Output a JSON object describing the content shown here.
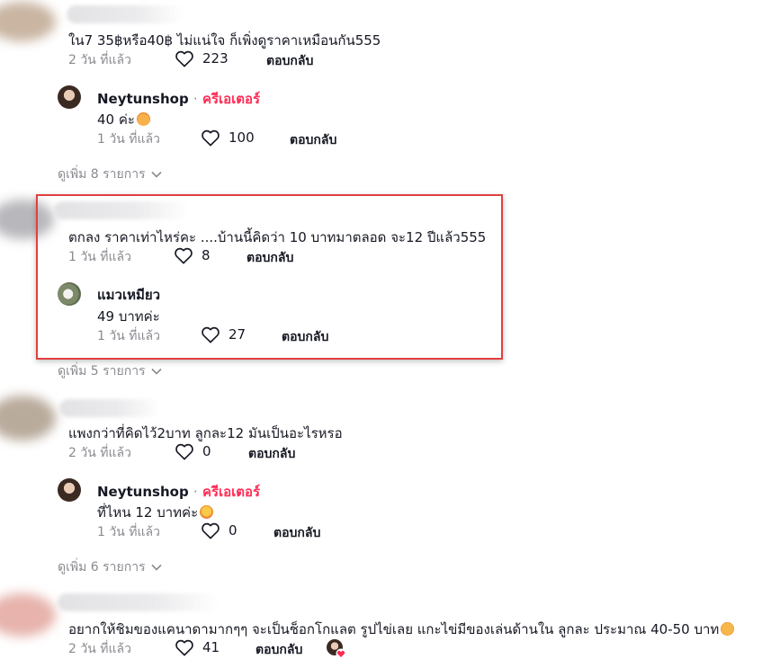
{
  "threads": [
    {
      "comment": {
        "text": "ใน7 35฿หรือ40฿ ไม่แน่ใจ ก็เพิ่งดูราคาเหมือนกัน555",
        "time": "2 วัน ที่แล้ว",
        "likes": "223",
        "reply_label": "ตอบกลับ"
      },
      "reply": {
        "username": "Neytunshop",
        "separator": "·",
        "badge": "ครีเอเตอร์",
        "text": "40 ค่ะ",
        "time": "1 วัน ที่แล้ว",
        "likes": "100",
        "reply_label": "ตอบกลับ"
      },
      "more": "ดูเพิ่ม 8 รายการ"
    },
    {
      "comment": {
        "text": "ตกลง ราคาเท่าไหร่คะ ....บ้านนี้คิดว่า 10 บาทมาตลอด จะ12 ปีแล้ว555",
        "time": "1 วัน ที่แล้ว",
        "likes": "8",
        "reply_label": "ตอบกลับ"
      },
      "reply": {
        "username": "แมวเหมียว",
        "text": "49 บาทค่ะ",
        "time": "1 วัน ที่แล้ว",
        "likes": "27",
        "reply_label": "ตอบกลับ"
      },
      "more": "ดูเพิ่ม 5 รายการ"
    },
    {
      "comment": {
        "text": "แพงกว่าที่คิดไว้2บาท ลูกละ12 มันเป็นอะไรหรอ",
        "time": "2 วัน ที่แล้ว",
        "likes": "0",
        "reply_label": "ตอบกลับ"
      },
      "reply": {
        "username": "Neytunshop",
        "separator": "·",
        "badge": "ครีเอเตอร์",
        "text": "ที่ไหน 12 บาทค่ะ",
        "time": "1 วัน ที่แล้ว",
        "likes": "0",
        "reply_label": "ตอบกลับ"
      },
      "more": "ดูเพิ่ม 6 รายการ"
    },
    {
      "comment": {
        "text": "อยากให้ชิมของแคนาดามากๆๆ จะเป็นช็อกโกแลต รูปไข่เลย แกะไข่มีของเล่นด้านใน ลูกละ ประมาณ 40-50 บาท",
        "time": "2 วัน ที่แล้ว",
        "likes": "41",
        "reply_label": "ตอบกลับ"
      }
    }
  ],
  "colors": {
    "creator_badge": "#fe2c55",
    "highlight_border": "#e0403f",
    "meta_text": "#8a8b91"
  },
  "icons": [
    "heart-outline-icon",
    "chevron-down-icon",
    "creator-liked-heart-icon"
  ]
}
